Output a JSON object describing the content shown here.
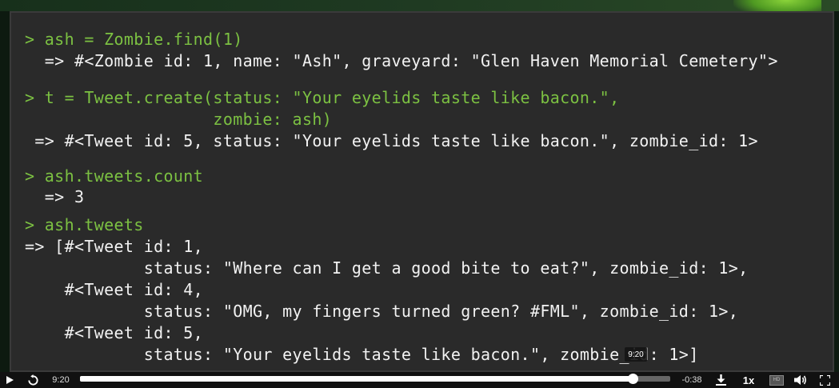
{
  "terminal": {
    "lines": [
      {
        "text": "> ash = Zombie.find(1)",
        "kind": "prompt"
      },
      {
        "text": "  => #<Zombie id: 1, name: \"Ash\", graveyard: \"Glen Haven Memorial Cemetery\">",
        "kind": "output"
      },
      {
        "text": "> t = Tweet.create(status: \"Your eyelids taste like bacon.\",",
        "kind": "prompt"
      },
      {
        "text": "                   zombie: ash)",
        "kind": "prompt"
      },
      {
        "text": " => #<Tweet id: 5, status: \"Your eyelids taste like bacon.\", zombie_id: 1>",
        "kind": "output"
      },
      {
        "text": "> ash.tweets.count",
        "kind": "prompt"
      },
      {
        "text": "  => 3",
        "kind": "output"
      },
      {
        "text": "> ash.tweets",
        "kind": "prompt"
      },
      {
        "text": "=> [#<Tweet id: 1,",
        "kind": "output"
      },
      {
        "text": "            status: \"Where can I get a good bite to eat?\", zombie_id: 1>,",
        "kind": "output"
      },
      {
        "text": "    #<Tweet id: 4,",
        "kind": "output"
      },
      {
        "text": "            status: \"OMG, my fingers turned green? #FML\", zombie_id: 1>,",
        "kind": "output"
      },
      {
        "text": "    #<Tweet id: 5,",
        "kind": "output"
      },
      {
        "text": "            status: \"Your eyelids taste like bacon.\", zombie_id: 1>]",
        "kind": "output"
      }
    ]
  },
  "player": {
    "current_time": "9:20",
    "remaining_time": "-0:38",
    "hover_time": "9:20",
    "progress": 0.936,
    "speed_label": "1x",
    "hd_label": "HD",
    "icons": {
      "play": "play-icon",
      "replay": "replay-icon",
      "download": "download-icon",
      "hd": "hd-icon",
      "volume": "volume-icon",
      "fullscreen": "fullscreen-icon"
    }
  },
  "colors": {
    "prompt": "#7cc142",
    "output": "#f2f2f2",
    "terminal_bg": "#2a2a2a"
  }
}
